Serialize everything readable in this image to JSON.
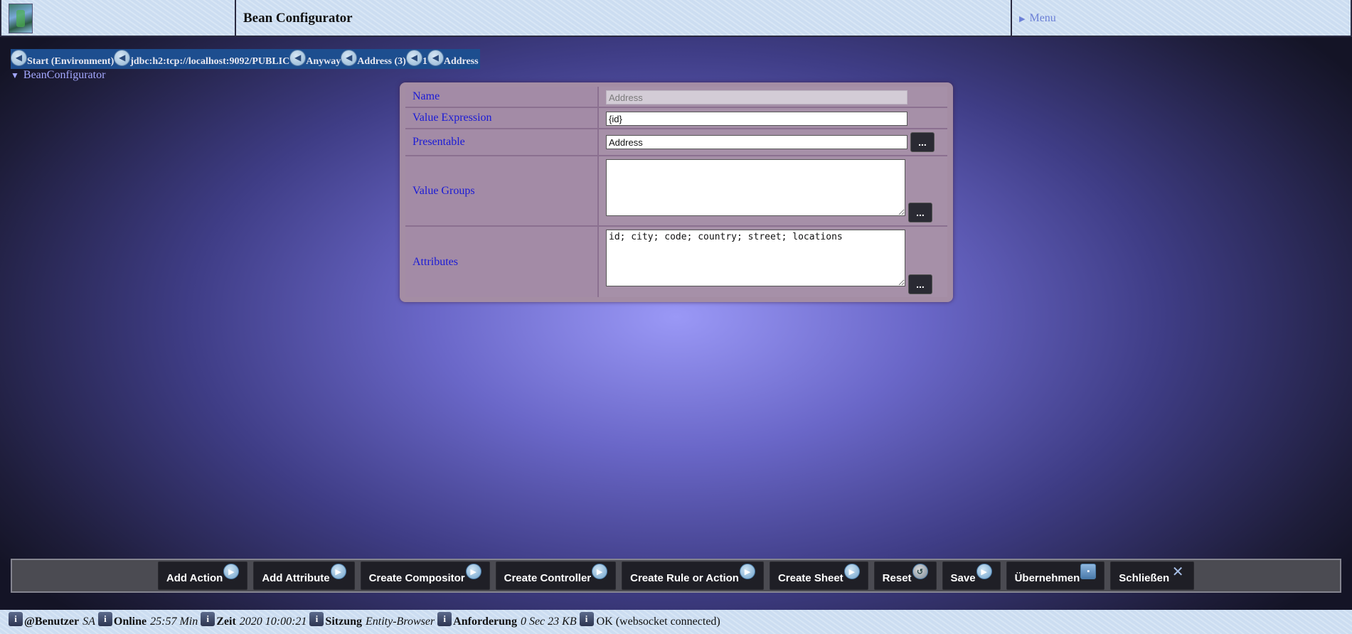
{
  "header": {
    "title": "Bean Configurator",
    "menu_label": "Menu"
  },
  "breadcrumb": [
    {
      "label": "Start (Environment)"
    },
    {
      "label": "jdbc:h2:tcp://localhost:9092/PUBLIC"
    },
    {
      "label": "Anyway"
    },
    {
      "label": "Address (3)"
    },
    {
      "label": "1"
    },
    {
      "label": "Address"
    }
  ],
  "tree": {
    "label": "BeanConfigurator"
  },
  "form": {
    "name_label": "Name",
    "name_value": "Address",
    "value_expression_label": "Value Expression",
    "value_expression_value": "{id}",
    "presentable_label": "Presentable",
    "presentable_value": "Address",
    "value_groups_label": "Value Groups",
    "value_groups_value": "",
    "attributes_label": "Attributes",
    "attributes_value": "id; city; code; country; street; locations",
    "more_label": "..."
  },
  "toolbar": {
    "buttons": [
      {
        "label": "Add Action",
        "icon": "play-icon"
      },
      {
        "label": "Add Attribute",
        "icon": "play-icon"
      },
      {
        "label": "Create Compositor",
        "icon": "play-icon"
      },
      {
        "label": "Create Controller",
        "icon": "play-icon"
      },
      {
        "label": "Create Rule or Action",
        "icon": "play-icon"
      },
      {
        "label": "Create Sheet",
        "icon": "play-icon"
      },
      {
        "label": "Reset",
        "icon": "reset-icon"
      },
      {
        "label": "Save",
        "icon": "play-icon"
      },
      {
        "label": "Übernehmen",
        "icon": "apply-icon"
      },
      {
        "label": "Schließen",
        "icon": "close-icon"
      }
    ]
  },
  "status": {
    "user_key": "@Benutzer",
    "user_value": "SA",
    "online_key": "Online",
    "online_value": "25:57 Min",
    "time_key": "Zeit",
    "time_value": "2020 10:00:21",
    "session_key": "Sitzung",
    "session_value": "Entity-Browser",
    "request_key": "Anforderung",
    "request_value": "0 Sec 23 KB",
    "message": "OK (websocket connected)"
  },
  "colors": {
    "header_bg": "#cfe0f3",
    "breadcrumb_bg": "#1d4e8f",
    "panel_bg": "#a48da4",
    "label_text": "#1a1ad6",
    "toolbar_bg": "#4b4b52",
    "button_bg": "#1f1f26"
  }
}
